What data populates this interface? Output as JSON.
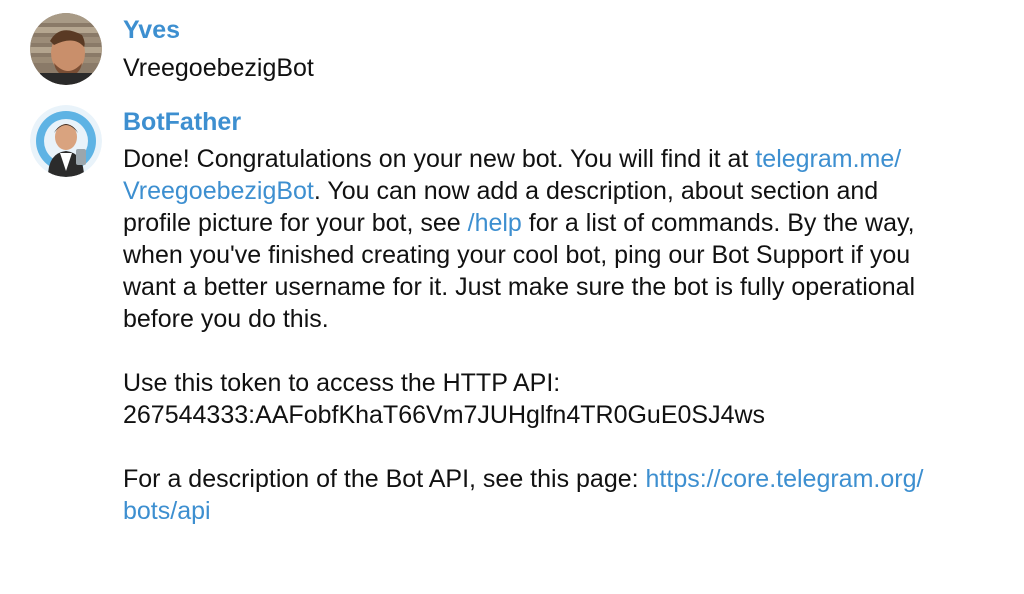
{
  "messages": [
    {
      "sender": "Yves",
      "lines": [
        "VreegoebezigBot"
      ]
    },
    {
      "sender": "BotFather",
      "lines": {
        "l1_a": "Done! Congratulations on your new bot. You will find it at ",
        "l1_link": "telegram.me/",
        "l2_link": "VreegoebezigBot",
        "l2_b": ". You can now add a description, about section and",
        "l3_a": "profile picture for your bot, see ",
        "l3_link": "/help",
        "l3_b": " for a list of commands. By the way,",
        "l4": "when you've finished creating your cool bot, ping our Bot Support if you",
        "l5": "want a better username for it. Just make sure the bot is fully operational",
        "l6": "before you do this.",
        "l7": "Use this token to access the HTTP API:",
        "l8": "267544333:AAFobfKhaT66Vm7JUHglfn4TR0GuE0SJ4ws",
        "l9_a": "For a description of the Bot API, see this page: ",
        "l9_link": "https://core.telegram.org/",
        "l10_link": "bots/api"
      }
    }
  ],
  "colors": {
    "link": "#3d8fd0",
    "sender": "#3d8fd0",
    "text": "#111111",
    "background": "#ffffff"
  },
  "icons": {
    "yves_avatar": "user-photo-avatar",
    "botfather_avatar": "botfather-avatar"
  }
}
